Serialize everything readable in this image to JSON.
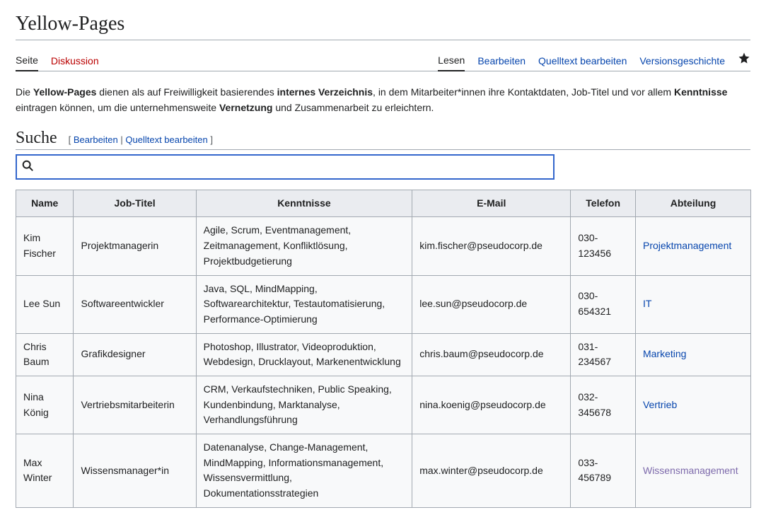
{
  "title": "Yellow-Pages",
  "tabs_left": [
    {
      "label": "Seite",
      "active": true,
      "red": false
    },
    {
      "label": "Diskussion",
      "active": false,
      "red": true
    }
  ],
  "tabs_right": [
    {
      "label": "Lesen",
      "active": true,
      "link": false
    },
    {
      "label": "Bearbeiten",
      "active": false,
      "link": true
    },
    {
      "label": "Quelltext bearbeiten",
      "active": false,
      "link": true
    },
    {
      "label": "Versionsgeschichte",
      "active": false,
      "link": true
    }
  ],
  "intro": {
    "text_pre": "Die ",
    "bold1": "Yellow-Pages",
    "text1": " dienen als auf Freiwilligkeit basierendes ",
    "bold2": "internes Verzeichnis",
    "text2": ", in dem Mitarbeiter*innen ihre Kontaktdaten, Job-Titel und vor allem ",
    "bold3": "Kenntnisse",
    "text3": " eintragen können, um die unternehmensweite ",
    "bold4": "Vernetzung",
    "text4": " und Zusammenarbeit zu erleichtern."
  },
  "section_search": "Suche",
  "edit": {
    "open": "[ ",
    "edit": "Bearbeiten",
    "sep": " | ",
    "src": "Quelltext bearbeiten",
    "close": " ]"
  },
  "search": {
    "value": "",
    "placeholder": ""
  },
  "table": {
    "headers": [
      "Name",
      "Job-Titel",
      "Kenntnisse",
      "E-Mail",
      "Telefon",
      "Abteilung"
    ],
    "rows": [
      {
        "name": "Kim Fischer",
        "job": "Projektmanagerin",
        "skills": "Agile, Scrum, Eventmanagement, Zeitmanagement, Konfliktlösung, Projektbudgetierung",
        "email": "kim.fischer@pseudocorp.de",
        "phone": "030-123456",
        "dept": "Projektmanagement",
        "dept_visited": false
      },
      {
        "name": "Lee Sun",
        "job": "Softwareentwickler",
        "skills": "Java, SQL, MindMapping, Softwarearchitektur, Testautomatisierung, Performance-Optimierung",
        "email": "lee.sun@pseudocorp.de",
        "phone": "030-654321",
        "dept": "IT",
        "dept_visited": false
      },
      {
        "name": "Chris Baum",
        "job": "Grafikdesigner",
        "skills": "Photoshop, Illustrator, Videoproduktion, Webdesign, Drucklayout, Markenentwicklung",
        "email": "chris.baum@pseudocorp.de",
        "phone": "031-234567",
        "dept": "Marketing",
        "dept_visited": false
      },
      {
        "name": "Nina König",
        "job": "Vertriebsmitarbeiterin",
        "skills": "CRM, Verkaufstechniken, Public Speaking, Kundenbindung, Marktanalyse, Verhandlungsführung",
        "email": "nina.koenig@pseudocorp.de",
        "phone": "032-345678",
        "dept": "Vertrieb",
        "dept_visited": false
      },
      {
        "name": "Max Winter",
        "job": "Wissensmanager*in",
        "skills": "Datenanalyse, Change-Management, MindMapping, Informationsmanagement, Wissensvermittlung, Dokumentationsstrategien",
        "email": "max.winter@pseudocorp.de",
        "phone": "033-456789",
        "dept": "Wissensmanagement",
        "dept_visited": true
      }
    ]
  }
}
